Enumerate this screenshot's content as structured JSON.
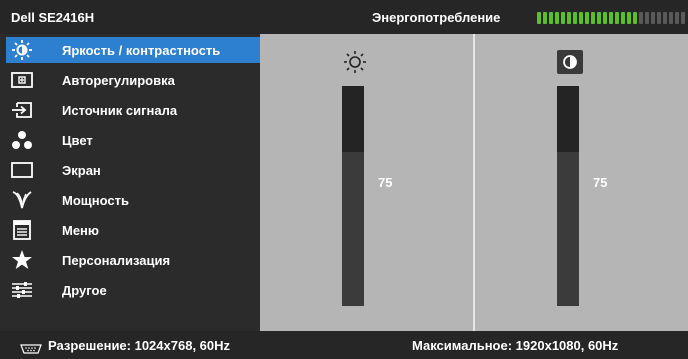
{
  "header": {
    "model": "Dell SE2416H",
    "power_label": "Энергопотребление",
    "power_meter": {
      "level": 0.68,
      "segments": 25
    }
  },
  "menu": {
    "items": [
      {
        "label": "Яркость / контрастность",
        "icon": "brightness-icon",
        "active": true
      },
      {
        "label": "Авторегулировка",
        "icon": "auto-adjust-icon",
        "active": false
      },
      {
        "label": "Источник сигнала",
        "icon": "input-source-icon",
        "active": false
      },
      {
        "label": "Цвет",
        "icon": "color-icon",
        "active": false
      },
      {
        "label": "Экран",
        "icon": "display-icon",
        "active": false
      },
      {
        "label": "Мощность",
        "icon": "power-icon",
        "active": false
      },
      {
        "label": "Меню",
        "icon": "menu-icon",
        "active": false
      },
      {
        "label": "Персонализация",
        "icon": "star-icon",
        "active": false
      },
      {
        "label": "Другое",
        "icon": "other-icon",
        "active": false
      }
    ]
  },
  "brightness": {
    "value": "75",
    "level": 0.75,
    "icon": "sun-icon"
  },
  "contrast": {
    "value": "75",
    "level": 0.75,
    "icon": "contrast-icon"
  },
  "footer": {
    "resolution": "Разрешение:  1024x768, 60Hz",
    "max_resolution": "Максимальное:  1920x1080, 60Hz"
  },
  "colors": {
    "accent": "#2d7fd0",
    "meter_on": "#5bbf2a",
    "panel": "#b5b5b5"
  }
}
